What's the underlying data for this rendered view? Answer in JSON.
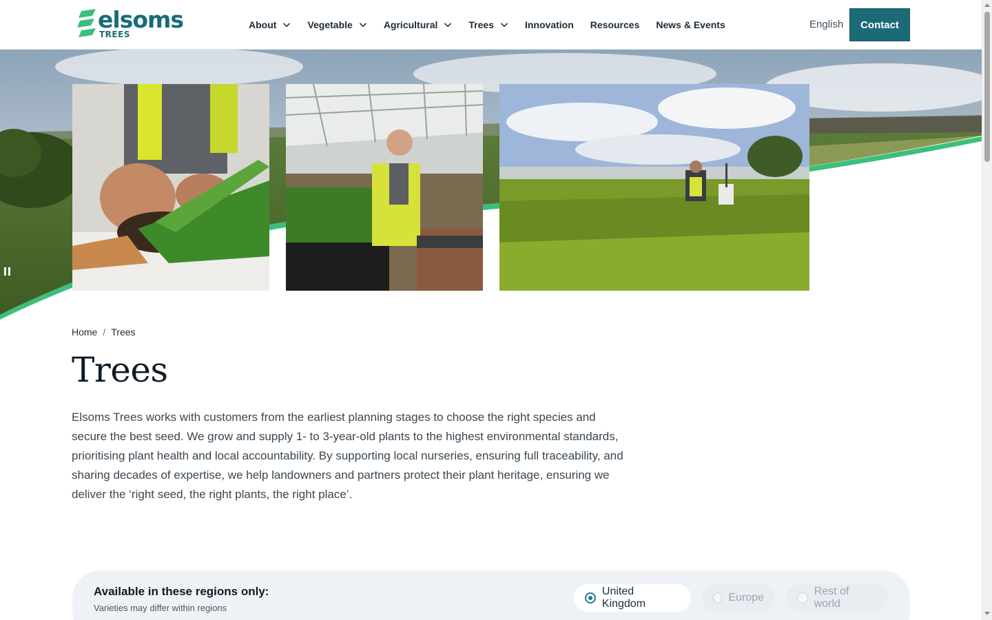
{
  "header": {
    "logo_text": "elsoms",
    "logo_sub": "TREES",
    "nav": [
      {
        "label": "About",
        "has_dropdown": true
      },
      {
        "label": "Vegetable",
        "has_dropdown": true
      },
      {
        "label": "Agricultural",
        "has_dropdown": true
      },
      {
        "label": "Trees",
        "has_dropdown": true
      },
      {
        "label": "Innovation",
        "has_dropdown": false
      },
      {
        "label": "Resources",
        "has_dropdown": false
      },
      {
        "label": "News & Events",
        "has_dropdown": false
      }
    ],
    "language": "English",
    "contact_label": "Contact"
  },
  "hero": {
    "images": [
      "seedling-roots-photo",
      "greenhouse-worker-photo",
      "tree-nursery-field-photo"
    ],
    "pause_icon": "pause-icon"
  },
  "breadcrumb": {
    "home": "Home",
    "separator": "/",
    "current": "Trees"
  },
  "page": {
    "title": "Trees",
    "intro": "Elsoms Trees works with customers from the earliest planning stages to choose the right species and secure the best seed. We grow and supply 1- to 3-year-old plants to the highest environmental standards, prioritising plant health and local accountability. By supporting local nurseries, ensuring full traceability, and sharing decades of expertise, we help landowners and partners protect their plant heritage, ensuring we deliver the ‘right seed, the right plants, the right place’."
  },
  "regions": {
    "title": "Available in these regions only:",
    "subtitle": "Varieties may differ within regions",
    "options": [
      {
        "label": "United Kingdom",
        "selected": true
      },
      {
        "label": "Europe",
        "selected": false
      },
      {
        "label": "Rest of world",
        "selected": false
      }
    ]
  },
  "colors": {
    "brand_teal": "#1a6b77",
    "brand_green": "#3cbf7c",
    "radio_accent": "#1a7f8f"
  }
}
